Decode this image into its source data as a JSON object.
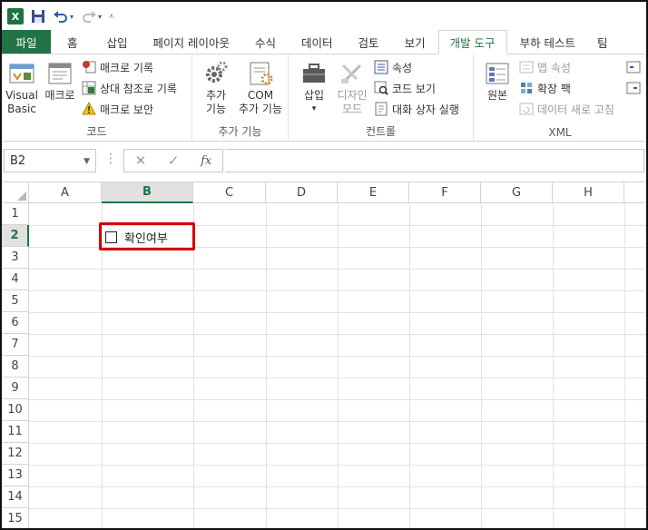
{
  "app": {
    "logo_letter": "X"
  },
  "qat": {
    "save_icon": "save-icon",
    "undo_icon": "undo-icon",
    "redo_icon": "redo-icon"
  },
  "tabs": [
    {
      "label": "파일",
      "type": "file"
    },
    {
      "label": "홈"
    },
    {
      "label": "삽입"
    },
    {
      "label": "페이지 레이아웃"
    },
    {
      "label": "수식"
    },
    {
      "label": "데이터"
    },
    {
      "label": "검토"
    },
    {
      "label": "보기"
    },
    {
      "label": "개발 도구",
      "active": true
    },
    {
      "label": "부하 테스트"
    },
    {
      "label": "팀"
    }
  ],
  "ribbon": {
    "code": {
      "label": "코드",
      "visual_basic_1": "Visual",
      "visual_basic_2": "Basic",
      "macro": "매크로",
      "record_macro": "매크로 기록",
      "relative_ref": "상대 참조로 기록",
      "macro_security": "매크로 보안"
    },
    "addins": {
      "label": "추가 기능",
      "addins_1": "추가",
      "addins_2": "기능",
      "com_1": "COM",
      "com_2": "추가 기능"
    },
    "controls": {
      "label": "컨트롤",
      "insert": "삽입",
      "design_1": "디자인",
      "design_2": "모드",
      "properties": "속성",
      "view_code": "코드 보기",
      "run_dialog": "대화 상자 실행"
    },
    "xml": {
      "label": "XML",
      "source": "원본",
      "map_properties": "맵 속성",
      "expansion_packs": "확장 팩",
      "refresh_data": "데이터 새로 고침"
    }
  },
  "formula_bar": {
    "name_box": "B2",
    "fx": "fx",
    "value": ""
  },
  "grid": {
    "columns": [
      "A",
      "B",
      "C",
      "D",
      "E",
      "F",
      "G",
      "H"
    ],
    "selected_column": "B",
    "rows": [
      "1",
      "2",
      "3",
      "4",
      "5",
      "6",
      "7",
      "8",
      "9",
      "10",
      "11",
      "12",
      "13",
      "14",
      "15"
    ],
    "selected_row": "2",
    "checkbox_label": "확인여부"
  },
  "colors": {
    "accent": "#217346",
    "highlight": "#d40000"
  }
}
